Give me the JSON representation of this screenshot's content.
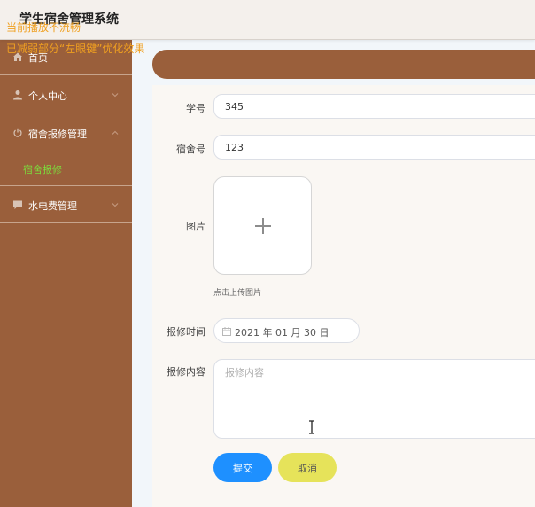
{
  "app": {
    "title": "学生宿舍管理系统"
  },
  "notices": [
    "当前播放不流畅",
    "已减弱部分“左眼键”优化效果"
  ],
  "sidebar": {
    "items": [
      {
        "label": "首页",
        "icon": "home-icon"
      },
      {
        "label": "个人中心",
        "icon": "user-icon"
      },
      {
        "label": "宿舍报修管理",
        "icon": "power-icon",
        "expanded": true
      },
      {
        "label": "水电费管理",
        "icon": "message-icon"
      }
    ],
    "sub_items": [
      {
        "label": "宿舍报修",
        "active": true
      }
    ]
  },
  "form": {
    "student_id": {
      "label": "学号",
      "value": "345"
    },
    "dorm_no": {
      "label": "宿舍号",
      "value": "123"
    },
    "image": {
      "label": "图片",
      "hint": "点击上传图片"
    },
    "repair_time": {
      "label": "报修时间",
      "value": "2021 年 01 月 30 日"
    },
    "repair_content": {
      "label": "报修内容",
      "placeholder": "报修内容",
      "value": ""
    },
    "submit_label": "提交",
    "cancel_label": "取消"
  },
  "colors": {
    "sidebar": "#9a5f3b",
    "active_sub": "#7cdc3c",
    "notice": "#f0a020",
    "submit": "#1e90ff",
    "cancel": "#e6e35a"
  }
}
